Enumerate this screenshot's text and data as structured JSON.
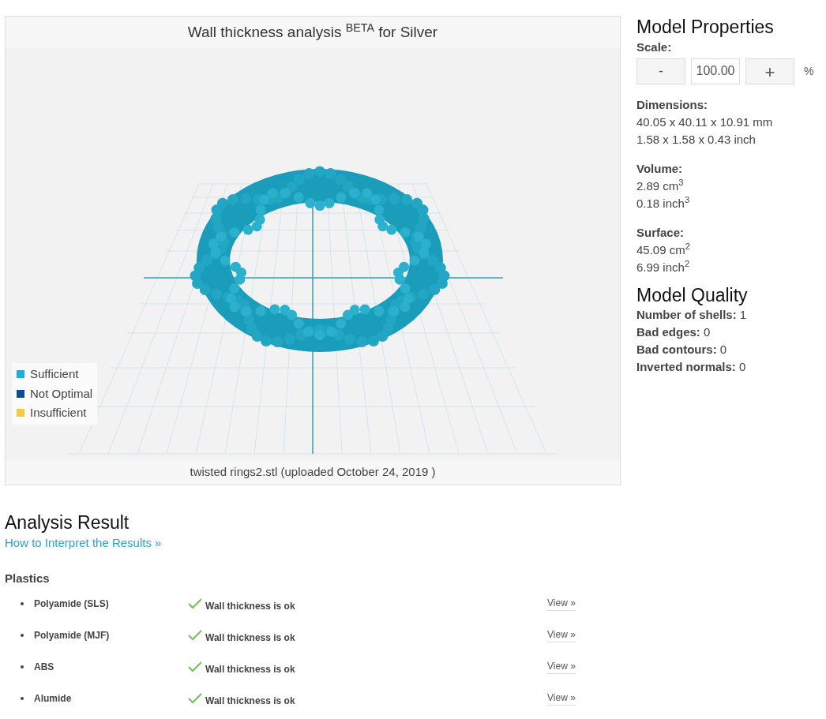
{
  "viewer": {
    "title": "Wall thickness analysis $^{BETA}$ for Silver",
    "legend": [
      {
        "label": "Sufficient",
        "color": "#1aaee6"
      },
      {
        "label": "Not Optimal",
        "color": "#0b4d9c"
      },
      {
        "label": "Insufficient",
        "color": "#f6c945"
      }
    ],
    "file_caption": "twisted rings2.stl (uploaded October 24, 2019 )"
  },
  "model_properties": {
    "title": "Model Properties",
    "scale_label": "Scale:",
    "decrease": "-",
    "scale_value": "100.00",
    "increase": "+",
    "unit": "%",
    "groups": [
      {
        "label": "Dimensions:",
        "lines": [
          "40.05 x 40.11 x 10.91 mm",
          "1.58 x 1.58 x 0.43 inch"
        ]
      },
      {
        "label": "Volume:",
        "lines": [
          "2.89 cm$^{3}$",
          "0.18 inch$^{3}$"
        ]
      },
      {
        "label": "Surface:",
        "lines": [
          "45.09 cm$^{2}$",
          "6.99 inch$^{2}$"
        ]
      }
    ]
  },
  "model_quality": {
    "title": "Model Quality",
    "items": [
      {
        "label": "Number of shells:",
        "value": "1"
      },
      {
        "label": "Bad edges:",
        "value": "0"
      },
      {
        "label": "Bad contours:",
        "value": "0"
      },
      {
        "label": "Inverted normals:",
        "value": "0"
      }
    ]
  },
  "analysis": {
    "title": "Analysis Result",
    "help_link": "How to Interpret the Results »",
    "section": "Plastics",
    "rows": [
      {
        "material": "Polyamide (SLS)",
        "kind": "ok",
        "message": "Wall thickness is ok",
        "link": "View »"
      },
      {
        "material": "Polyamide (MJF)",
        "kind": "ok",
        "message": "Wall thickness is ok",
        "link": "View »"
      },
      {
        "material": "ABS",
        "kind": "ok",
        "message": "Wall thickness is ok",
        "link": "View »"
      },
      {
        "material": "Alumide",
        "kind": "ok",
        "message": "Wall thickness is ok",
        "link": "View »"
      }
    ]
  }
}
